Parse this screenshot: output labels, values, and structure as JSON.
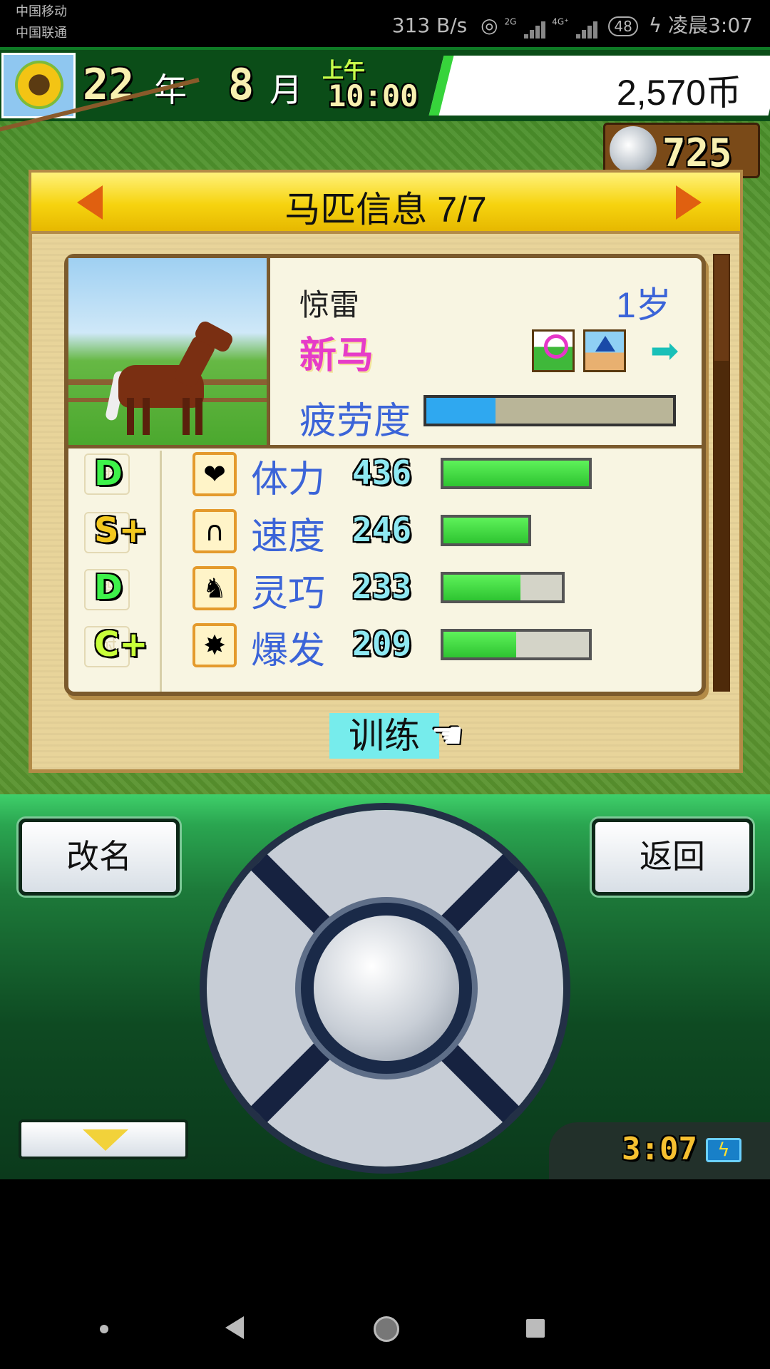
{
  "status_bar": {
    "carrier_1": "中国移动",
    "carrier_2": "中国联通",
    "net_speed": "313 B/s",
    "network_1": "2G",
    "network_2": "4G⁺",
    "battery": "48",
    "time": "凌晨3:07"
  },
  "header": {
    "year": "22",
    "year_unit": "年",
    "month": "8",
    "month_unit": "月",
    "period": "上午",
    "time": "10:00",
    "coins": "2,570币",
    "horseshoe_count": "725"
  },
  "panel": {
    "title": "马匹信息 7/7",
    "horse_name": "惊雷",
    "horse_age": "1岁",
    "horse_tag": "新马",
    "fatigue_label": "疲劳度",
    "fatigue_level": 0.28,
    "stats": [
      {
        "grade": "D",
        "label": "体力",
        "value": "436",
        "fill": 1.0,
        "bar_max": 1.0,
        "icon": "heart-icon",
        "glyph": "❤"
      },
      {
        "grade": "S+",
        "label": "速度",
        "value": "246",
        "fill": 1.0,
        "bar_max": 0.6,
        "icon": "horseshoe-icon",
        "glyph": "∩"
      },
      {
        "grade": "D",
        "label": "灵巧",
        "value": "233",
        "fill": 0.65,
        "bar_max": 0.82,
        "icon": "horse-icon",
        "glyph": "♞"
      },
      {
        "grade": "C+",
        "label": "爆发",
        "value": "209",
        "fill": 0.5,
        "bar_max": 1.0,
        "icon": "burst-icon",
        "glyph": "✸"
      }
    ],
    "train_label": "训练"
  },
  "controls": {
    "rename_label": "改名",
    "back_label": "返回",
    "clock": "3:07"
  },
  "colors": {
    "title_yellow": "#f6d30f",
    "stat_blue": "#3b64d8",
    "tag_pink": "#e63cc8",
    "bar_green": "#2ec431",
    "fatigue_blue": "#2fa8f0"
  }
}
